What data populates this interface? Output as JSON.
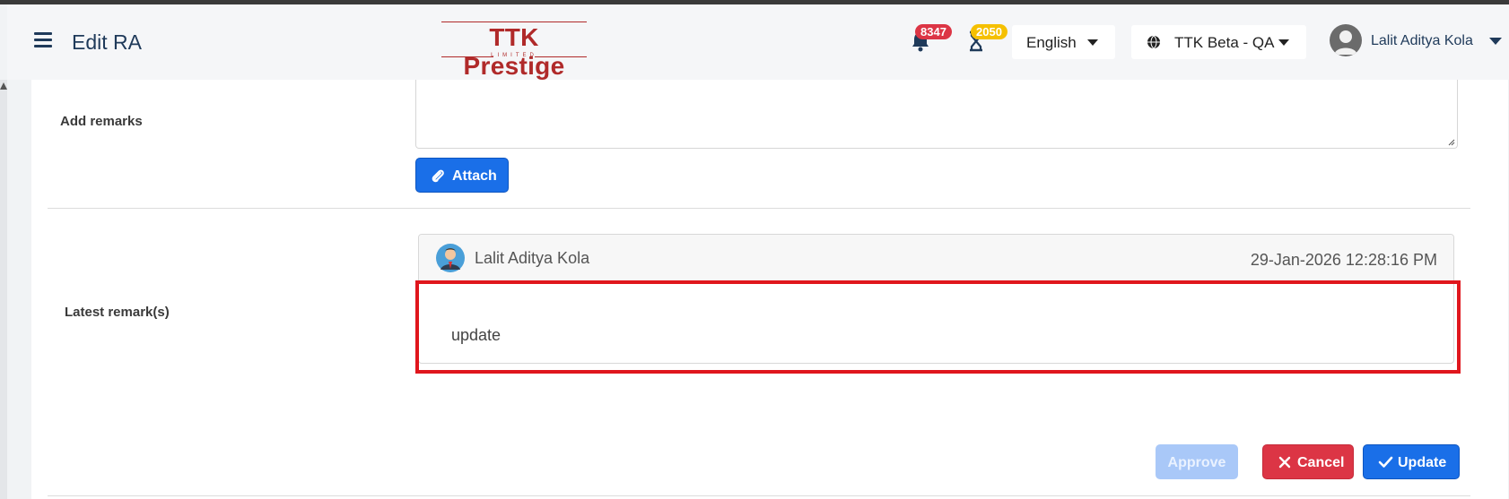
{
  "header": {
    "menu_icon": "hamburger-icon",
    "page_title": "Edit RA",
    "logo": {
      "main": "TTK Prestige",
      "sub": "LIMITED"
    },
    "notifications": {
      "icon": "bell-icon",
      "count": "8347"
    },
    "pending": {
      "icon": "hourglass-icon",
      "count": "2050"
    },
    "language": {
      "selected": "English"
    },
    "organization": {
      "icon": "globe-icon",
      "selected": "TTK Beta - QA"
    },
    "user": {
      "name": "Lalit Aditya Kola",
      "icon": "user-avatar-icon"
    }
  },
  "form": {
    "add_remarks_label": "Add remarks",
    "remarks_value": "",
    "attach_label": "Attach",
    "latest_remarks_label": "Latest remark(s)"
  },
  "remark": {
    "author": "Lalit Aditya Kola",
    "timestamp": "29-Jan-2026 12:28:16 PM",
    "text": "update"
  },
  "actions": {
    "approve_label": "Approve",
    "cancel_label": "Cancel",
    "update_label": "Update"
  },
  "colors": {
    "primary": "#1a6fe8",
    "danger": "#dc3545",
    "approve_disabled": "#a9c8f8",
    "brand": "#b02a2a",
    "highlight": "#e0161d",
    "title": "#1f3a5a"
  }
}
